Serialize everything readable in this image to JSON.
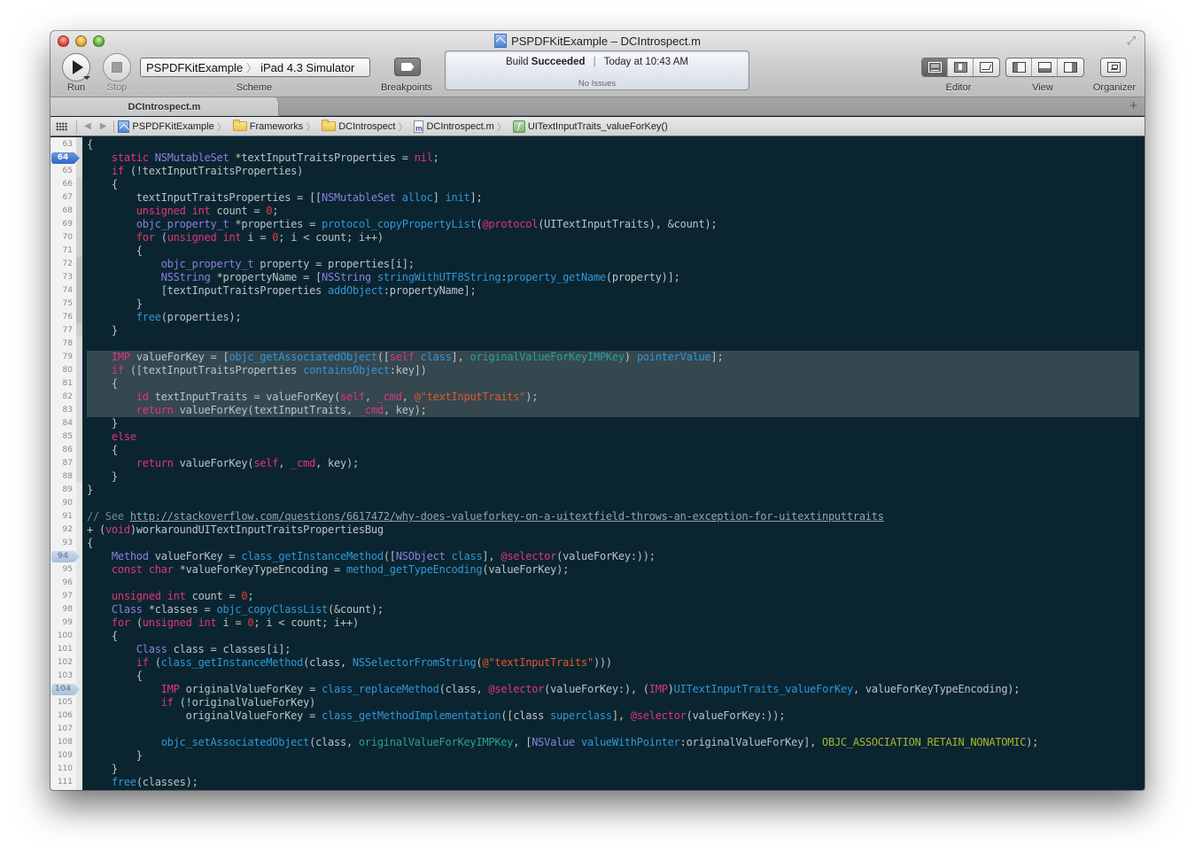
{
  "window": {
    "title": "PSPDFKitExample – DCIntrospect.m"
  },
  "toolbar": {
    "run_label": "Run",
    "stop_label": "Stop",
    "scheme_target": "PSPDFKitExample",
    "scheme_destination": "iPad 4.3 Simulator",
    "scheme_label": "Scheme",
    "breakpoints_label": "Breakpoints",
    "editor_label": "Editor",
    "view_label": "View",
    "organizer_label": "Organizer"
  },
  "activity": {
    "build_prefix": "Build",
    "build_status": "Succeeded",
    "time": "Today at 10:43 AM",
    "issues": "No Issues"
  },
  "tabs": [
    {
      "label": "DCIntrospect.m",
      "active": true
    }
  ],
  "jumpbar": {
    "project": "PSPDFKitExample",
    "group1": "Frameworks",
    "group2": "DCIntrospect",
    "file": "DCIntrospect.m",
    "symbol": "UITextInputTraits_valueForKey()"
  },
  "editor": {
    "breakpoints": [
      {
        "line": 64,
        "enabled": true
      },
      {
        "line": 94,
        "enabled": false
      },
      {
        "line": 104,
        "enabled": false
      }
    ],
    "highlighted_lines": [
      79,
      80,
      81,
      82,
      83
    ],
    "lines": [
      {
        "n": "63",
        "code": "{"
      },
      {
        "n": "64",
        "code": "    static NSMutableSet *textInputTraitsProperties = nil;"
      },
      {
        "n": "65",
        "code": "    if (!textInputTraitsProperties)"
      },
      {
        "n": "66",
        "code": "    {"
      },
      {
        "n": "67",
        "code": "        textInputTraitsProperties = [[NSMutableSet alloc] init];"
      },
      {
        "n": "68",
        "code": "        unsigned int count = 0;"
      },
      {
        "n": "69",
        "code": "        objc_property_t *properties = protocol_copyPropertyList(@protocol(UITextInputTraits), &count);"
      },
      {
        "n": "70",
        "code": "        for (unsigned int i = 0; i < count; i++)"
      },
      {
        "n": "71",
        "code": "        {"
      },
      {
        "n": "72",
        "code": "            objc_property_t property = properties[i];"
      },
      {
        "n": "73",
        "code": "            NSString *propertyName = [NSString stringWithUTF8String:property_getName(property)];"
      },
      {
        "n": "74",
        "code": "            [textInputTraitsProperties addObject:propertyName];"
      },
      {
        "n": "75",
        "code": "        }"
      },
      {
        "n": "76",
        "code": "        free(properties);"
      },
      {
        "n": "77",
        "code": "    }"
      },
      {
        "n": "78",
        "code": ""
      },
      {
        "n": "79",
        "code": "    IMP valueForKey = [objc_getAssociatedObject([self class], originalValueForKeyIMPKey) pointerValue];"
      },
      {
        "n": "80",
        "code": "    if ([textInputTraitsProperties containsObject:key])"
      },
      {
        "n": "81",
        "code": "    {"
      },
      {
        "n": "82",
        "code": "        id textInputTraits = valueForKey(self, _cmd, @\"textInputTraits\");"
      },
      {
        "n": "83",
        "code": "        return valueForKey(textInputTraits, _cmd, key);"
      },
      {
        "n": "84",
        "code": "    }"
      },
      {
        "n": "85",
        "code": "    else"
      },
      {
        "n": "86",
        "code": "    {"
      },
      {
        "n": "87",
        "code": "        return valueForKey(self, _cmd, key);"
      },
      {
        "n": "88",
        "code": "    }"
      },
      {
        "n": "89",
        "code": "}"
      },
      {
        "n": "90",
        "code": ""
      },
      {
        "n": "91",
        "code": "// See http://stackoverflow.com/questions/6617472/why-does-valueforkey-on-a-uitextfield-throws-an-exception-for-uitextinputtraits"
      },
      {
        "n": "92",
        "code": "+ (void)workaroundUITextInputTraitsPropertiesBug"
      },
      {
        "n": "93",
        "code": "{"
      },
      {
        "n": "94",
        "code": "    Method valueForKey = class_getInstanceMethod([NSObject class], @selector(valueForKey:));"
      },
      {
        "n": "95",
        "code": "    const char *valueForKeyTypeEncoding = method_getTypeEncoding(valueForKey);"
      },
      {
        "n": "96",
        "code": ""
      },
      {
        "n": "97",
        "code": "    unsigned int count = 0;"
      },
      {
        "n": "98",
        "code": "    Class *classes = objc_copyClassList(&count);"
      },
      {
        "n": "99",
        "code": "    for (unsigned int i = 0; i < count; i++)"
      },
      {
        "n": "100",
        "code": "    {"
      },
      {
        "n": "101",
        "code": "        Class class = classes[i];"
      },
      {
        "n": "102",
        "code": "        if (class_getInstanceMethod(class, NSSelectorFromString(@\"textInputTraits\")))"
      },
      {
        "n": "103",
        "code": "        {"
      },
      {
        "n": "104",
        "code": "            IMP originalValueForKey = class_replaceMethod(class, @selector(valueForKey:), (IMP)UITextInputTraits_valueForKey, valueForKeyTypeEncoding);"
      },
      {
        "n": "105",
        "code": "            if (!originalValueForKey)"
      },
      {
        "n": "106",
        "code": "                originalValueForKey = class_getMethodImplementation([class superclass], @selector(valueForKey:));"
      },
      {
        "n": "107",
        "code": ""
      },
      {
        "n": "108",
        "code": "            objc_setAssociatedObject(class, originalValueForKeyIMPKey, [NSValue valueWithPointer:originalValueForKey], OBJC_ASSOCIATION_RETAIN_NONATOMIC);"
      },
      {
        "n": "109",
        "code": "        }"
      },
      {
        "n": "110",
        "code": "    }"
      },
      {
        "n": "111",
        "code": "    free(classes);"
      }
    ]
  },
  "syntax_colors": {
    "background": "#0b2530",
    "plain": "#b9c4c6",
    "keyword": "#e0357a",
    "type": "#8b7fe0",
    "function": "#2f97d9",
    "number": "#e53a2f",
    "string": "#e0582a",
    "comment": "#6c8a93",
    "global": "#2aa198",
    "macro": "#a5b531",
    "highlight": "#35474f"
  }
}
